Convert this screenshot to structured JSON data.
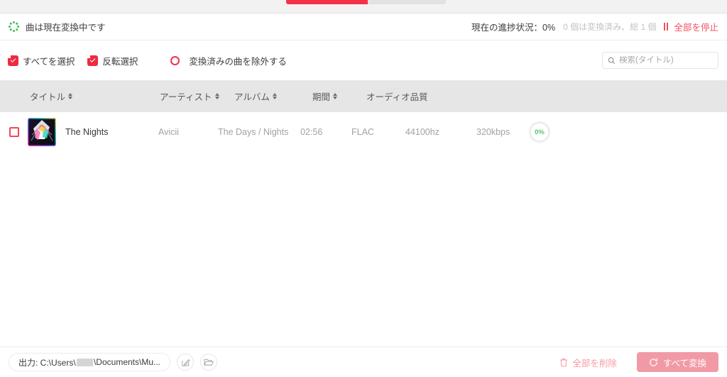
{
  "tabstrip": {
    "active_tab_color": "#f5314a",
    "track_color": "#e2e2e3"
  },
  "status": {
    "spinner_icon": "loading-spinner-icon",
    "message": "曲は現在変換中です",
    "progress_label": "現在の進捗状況：0%",
    "progress_detail": "0 個は変換済み、総 1 個",
    "stop_icon": "pause-icon",
    "stop_label": "全部を停止",
    "accent_color": "#f15063"
  },
  "toolbar": {
    "select_all_icon": "checkbox-checked-icon",
    "select_all_label": "すべてを選択",
    "invert_icon": "checkbox-checked-icon",
    "invert_label": "反転選択",
    "exclude_icon": "radio-unchecked-icon",
    "exclude_label": "変換済みの曲を除外する",
    "search": {
      "icon": "search-icon",
      "value": "",
      "placeholder": "検索(タイトル)"
    }
  },
  "table": {
    "columns": [
      {
        "label": "タイトル",
        "sortable": true
      },
      {
        "label": "アーティスト",
        "sortable": true
      },
      {
        "label": "アルバム",
        "sortable": true
      },
      {
        "label": "期間",
        "sortable": true
      },
      {
        "label": "オーディオ品質",
        "sortable": false
      }
    ],
    "rows": [
      {
        "checked": false,
        "artwork": "album-artwork",
        "title": "The Nights",
        "artist": "Avicii",
        "album": "The Days / Nights",
        "duration": "02:56",
        "format": "FLAC",
        "samplerate": "44100hz",
        "bitrate": "320kbps",
        "progress": "0%",
        "progress_color": "#59c36a"
      }
    ]
  },
  "footer": {
    "output_prefix": "出力: C:\\Users\\",
    "output_suffix": "\\Documents\\Mu...",
    "edit_icon": "edit-pencil-icon",
    "folder_icon": "folder-open-icon",
    "delete_all_icon": "trash-icon",
    "delete_all_label": "全部を削除",
    "convert_icon": "refresh-icon",
    "convert_label": "すべて変換",
    "convert_color": "#f19aa5"
  }
}
